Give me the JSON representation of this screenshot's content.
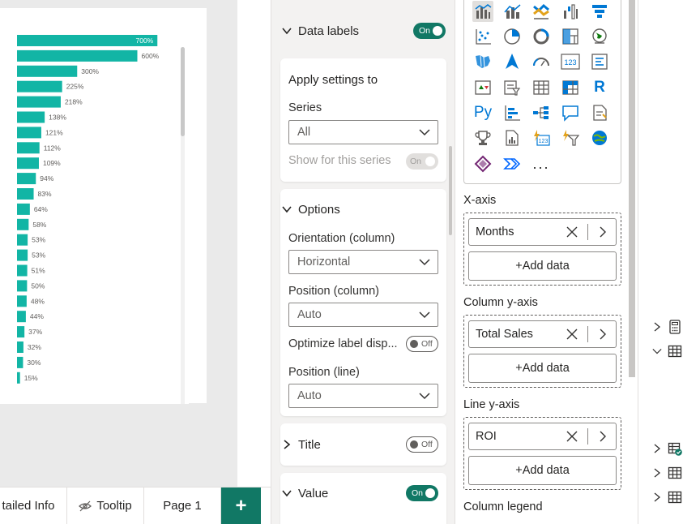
{
  "page_tabs": [
    {
      "label": "tailed Info"
    },
    {
      "label": "Tooltip",
      "icon": "hidden-eye-icon"
    },
    {
      "label": "Page 1"
    }
  ],
  "add_page_label": "+",
  "format_pane": {
    "data_labels": {
      "title": "Data labels",
      "toggle": "On"
    },
    "apply_settings": {
      "title": "Apply settings to",
      "series_label": "Series",
      "series_value": "All",
      "show_for_series_label": "Show for this series",
      "show_for_series_toggle": "On"
    },
    "options": {
      "title": "Options",
      "orientation_label": "Orientation (column)",
      "orientation_value": "Horizontal",
      "position_column_label": "Position (column)",
      "position_column_value": "Auto",
      "optimize_label": "Optimize label disp...",
      "optimize_toggle": "Off",
      "position_line_label": "Position (line)",
      "position_line_value": "Auto"
    },
    "title_section": {
      "title": "Title",
      "toggle": "Off"
    },
    "value_section": {
      "title": "Value",
      "toggle": "On"
    }
  },
  "viz_pane": {
    "more_label": "...",
    "x_axis": {
      "label": "X-axis",
      "field": "Months",
      "add": "+Add data"
    },
    "column_y_axis": {
      "label": "Column y-axis",
      "field": "Total Sales",
      "add": "+Add data"
    },
    "line_y_axis": {
      "label": "Line y-axis",
      "field": "ROI",
      "add": "+Add data"
    },
    "column_legend": {
      "label": "Column legend"
    },
    "python_label": "Py",
    "r_label": "R",
    "card_label": "123"
  },
  "chart_data": {
    "type": "bar",
    "orientation": "horizontal",
    "color": "#12B5A5",
    "values": [
      700,
      600,
      300,
      225,
      218,
      138,
      121,
      112,
      109,
      94,
      83,
      64,
      58,
      53,
      53,
      51,
      50,
      48,
      44,
      37,
      32,
      30,
      15
    ],
    "labels": [
      "700%",
      "600%",
      "300%",
      "225%",
      "218%",
      "138%",
      "121%",
      "112%",
      "109%",
      "94%",
      "83%",
      "64%",
      "58%",
      "53%",
      "53%",
      "51%",
      "50%",
      "48%",
      "44%",
      "37%",
      "32%",
      "30%",
      "15%"
    ],
    "xlim": [
      0,
      800
    ],
    "grid": false
  }
}
